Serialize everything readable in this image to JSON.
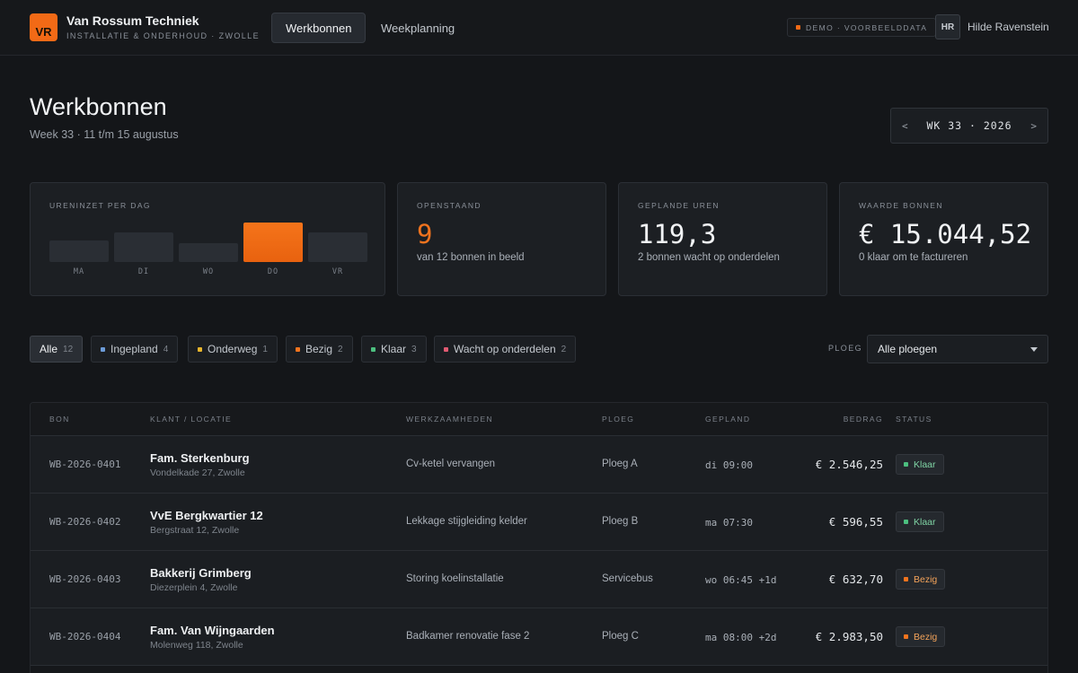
{
  "header": {
    "logo_text": "VR",
    "company_name": "Van Rossum Techniek",
    "company_tagline": "INSTALLATIE & ONDERHOUD · ZWOLLE",
    "tabs": [
      {
        "label": "Werkbonnen",
        "active": true
      },
      {
        "label": "Weekplanning",
        "active": false
      }
    ],
    "demo_badge": "DEMO · VOORBEELDDATA",
    "user_initials": "HR",
    "user_name": "Hilde Ravenstein"
  },
  "page": {
    "title": "Werkbonnen",
    "subtitle": "Week 33 · 11 t/m 15 augustus",
    "week_label": "WK 33 · 2026",
    "prev_glyph": "<",
    "next_glyph": ">"
  },
  "stats": {
    "hours_chart": {
      "label": "URENINZET PER DAG",
      "days": [
        {
          "day": "MA",
          "level": 0.55
        },
        {
          "day": "DI",
          "level": 0.75
        },
        {
          "day": "WO",
          "level": 0.48
        },
        {
          "day": "DO",
          "level": 1.0,
          "highlight": true
        },
        {
          "day": "VR",
          "level": 0.75
        }
      ]
    },
    "open": {
      "label": "OPENSTAAND",
      "value": "9",
      "note": "van 12 bonnen in beeld"
    },
    "hours": {
      "label": "GEPLANDE UREN",
      "value": "119,3",
      "note": "2 bonnen wacht op onderdelen"
    },
    "worth": {
      "label": "WAARDE BONNEN",
      "value": "€ 15.044,52",
      "note": "0 klaar om te factureren"
    }
  },
  "filters": {
    "chips": [
      {
        "label": "Alle",
        "count": "12",
        "active": true
      },
      {
        "label": "Ingepland",
        "count": "4",
        "color": "#6c9bd8"
      },
      {
        "label": "Onderweg",
        "count": "1",
        "color": "#e8b52c"
      },
      {
        "label": "Bezig",
        "count": "2",
        "color": "#f2741e"
      },
      {
        "label": "Klaar",
        "count": "3",
        "color": "#4cbf7f"
      },
      {
        "label": "Wacht op onderdelen",
        "count": "2",
        "color": "#e05a72"
      }
    ],
    "ploeg_label": "PLOEG",
    "ploeg_value": "Alle ploegen"
  },
  "table": {
    "columns": {
      "bon": "BON",
      "klant": "KLANT / LOCATIE",
      "werk": "WERKZAAMHEDEN",
      "ploeg": "PLOEG",
      "gepland": "GEPLAND",
      "bedrag": "BEDRAG",
      "status": "STATUS"
    },
    "rows": [
      {
        "bon": "WB-2026-0401",
        "klant": "Fam. Sterkenburg",
        "locatie": "Vondelkade 27, Zwolle",
        "werk": "Cv-ketel vervangen",
        "ploeg": "Ploeg A",
        "gepland": "di 09:00",
        "bedrag": "€ 2.546,25",
        "status": "Klaar"
      },
      {
        "bon": "WB-2026-0402",
        "klant": "VvE Bergkwartier 12",
        "locatie": "Bergstraat 12, Zwolle",
        "werk": "Lekkage stijgleiding kelder",
        "ploeg": "Ploeg B",
        "gepland": "ma 07:30",
        "bedrag": "€ 596,55",
        "status": "Klaar"
      },
      {
        "bon": "WB-2026-0403",
        "klant": "Bakkerij Grimberg",
        "locatie": "Diezerplein 4, Zwolle",
        "werk": "Storing koelinstallatie",
        "ploeg": "Servicebus",
        "gepland": "wo 06:45 +1d",
        "bedrag": "€ 632,70",
        "status": "Bezig"
      },
      {
        "bon": "WB-2026-0404",
        "klant": "Fam. Van Wijngaarden",
        "locatie": "Molenweg 118, Zwolle",
        "werk": "Badkamer renovatie fase 2",
        "ploeg": "Ploeg C",
        "gepland": "ma 08:00 +2d",
        "bedrag": "€ 2.983,50",
        "status": "Bezig"
      }
    ]
  },
  "colors": {
    "accent": "#f26a16",
    "klaar": "#4cbf7f",
    "bezig": "#f2741e"
  }
}
